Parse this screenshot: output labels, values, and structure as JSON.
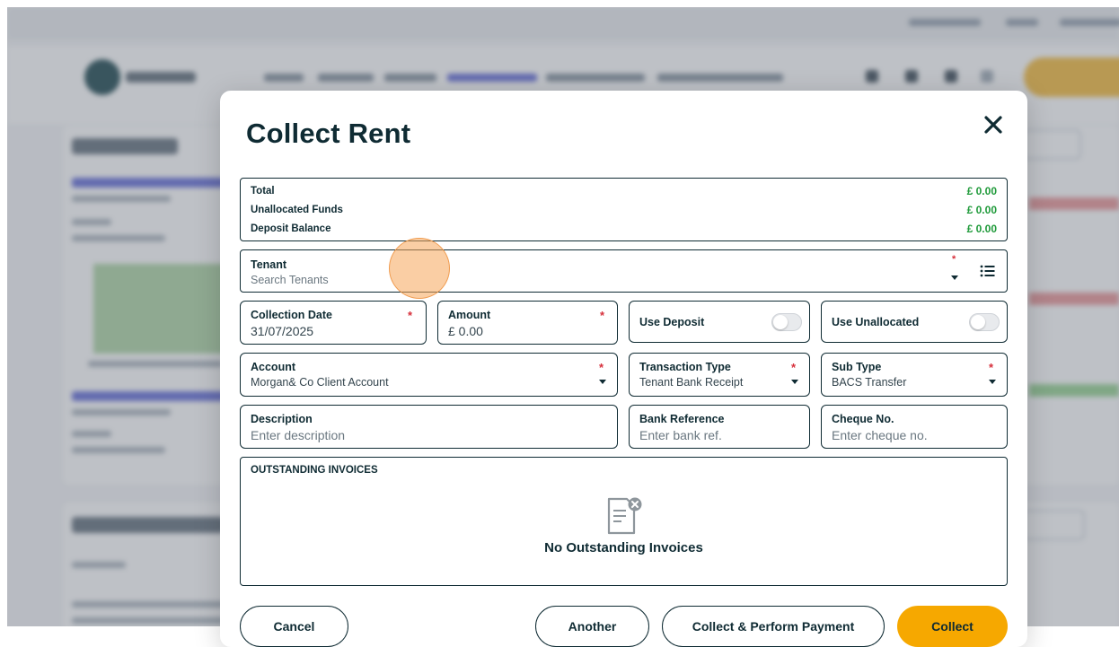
{
  "modal": {
    "title": "Collect Rent",
    "summary": {
      "total_label": "Total",
      "total_value": "£ 0.00",
      "unallocated_label": "Unallocated Funds",
      "unallocated_value": "£ 0.00",
      "deposit_label": "Deposit Balance",
      "deposit_value": "£ 0.00"
    },
    "tenant": {
      "label": "Tenant",
      "placeholder": "Search Tenants",
      "required": "*"
    },
    "collection_date": {
      "label": "Collection Date",
      "value": "31/07/2025",
      "required": "*"
    },
    "amount": {
      "label": "Amount",
      "value": "£ 0.00",
      "required": "*"
    },
    "use_deposit": {
      "label": "Use Deposit",
      "enabled": false
    },
    "use_unallocated": {
      "label": "Use Unallocated",
      "enabled": false
    },
    "account": {
      "label": "Account",
      "value": "Morgan& Co Client Account",
      "required": "*"
    },
    "transaction_type": {
      "label": "Transaction Type",
      "value": "Tenant Bank Receipt",
      "required": "*"
    },
    "sub_type": {
      "label": "Sub Type",
      "value": "BACS Transfer",
      "required": "*"
    },
    "description": {
      "label": "Description",
      "placeholder": "Enter description"
    },
    "bank_reference": {
      "label": "Bank Reference",
      "placeholder": "Enter bank ref."
    },
    "cheque_no": {
      "label": "Cheque No.",
      "placeholder": "Enter cheque no."
    },
    "outstanding": {
      "header": "OUTSTANDING INVOICES",
      "empty_message": "No Outstanding Invoices"
    },
    "buttons": {
      "cancel": "Cancel",
      "another": "Another",
      "collect_perform": "Collect & Perform Payment",
      "collect": "Collect"
    }
  },
  "colors": {
    "accent": "#f6a800",
    "brand_dark": "#0f2b33",
    "positive": "#1f9a3a",
    "required": "#d62f3a"
  }
}
